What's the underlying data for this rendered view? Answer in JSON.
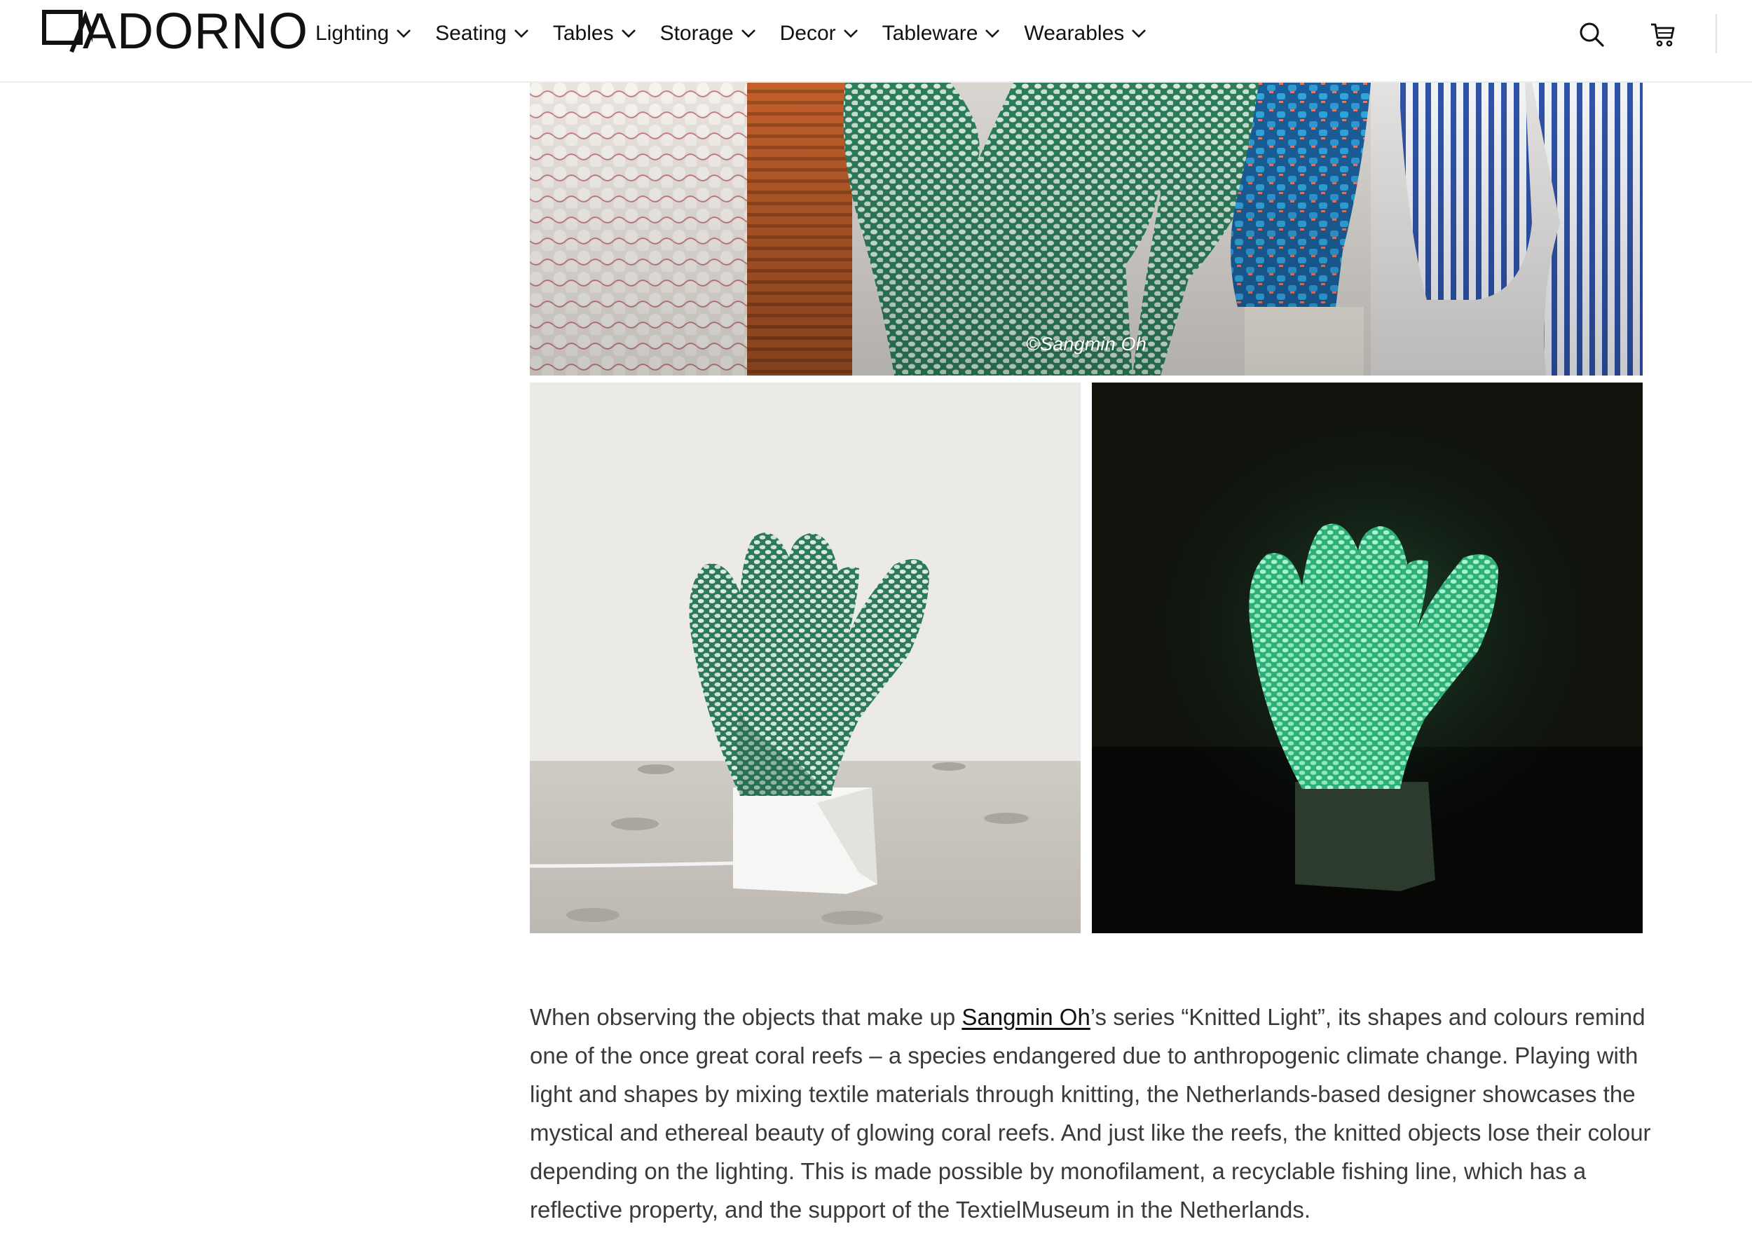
{
  "brand": {
    "name": "ADORNO"
  },
  "nav": {
    "items": [
      {
        "label": "Lighting"
      },
      {
        "label": "Seating"
      },
      {
        "label": "Tables"
      },
      {
        "label": "Storage"
      },
      {
        "label": "Decor"
      },
      {
        "label": "Tableware"
      },
      {
        "label": "Wearables"
      }
    ]
  },
  "header_icons": {
    "search": "search-icon",
    "cart": "cart-icon"
  },
  "gallery": {
    "top_caption": "©Sangmin Oh"
  },
  "article": {
    "before_link": "When observing the objects that make up ",
    "link_text": "Sangmin Oh",
    "after_link": "’s series “Knitted Light”, its shapes and colours remind one of the once great coral reefs – a species endangered due to anthropogenic climate change. Playing with light and shapes by mixing textile materials through knitting, the Netherlands-based designer showcases the mystical and ethereal beauty of glowing coral reefs. And just like the reefs, the knitted objects lose their colour depending on the lighting. This is made possible by monofilament, a recyclable fishing line, which has a reflective property, and the support of the TextielMuseum in the Netherlands."
  },
  "colors": {
    "text": "#3a3a3a",
    "link": "#111111",
    "knit_green": "#3f9a73",
    "glow_green": "#63e0a4"
  }
}
